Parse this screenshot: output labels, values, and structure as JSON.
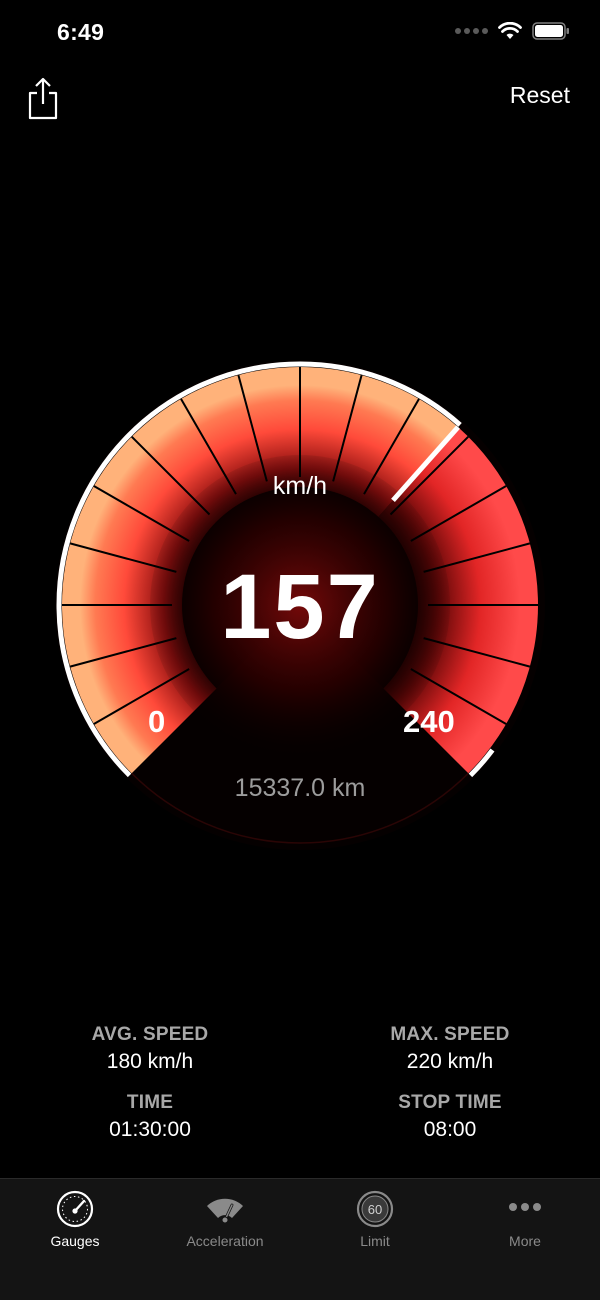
{
  "status_bar": {
    "time": "6:49",
    "icons": [
      "signal-dots-icon",
      "wifi-icon",
      "battery-icon"
    ]
  },
  "top_bar": {
    "share_icon": "share-icon",
    "reset_label": "Reset"
  },
  "gauge": {
    "unit": "km/h",
    "speed": "157",
    "min_label": "0",
    "max_label": "240",
    "odometer": "15337.0 km",
    "speed_value": 157,
    "min_value": 0,
    "max_value": 240,
    "colors": {
      "active": "#ff3b3b",
      "glow": "#ffb27a",
      "needle": "#ffffff",
      "rim": "#ffffff"
    }
  },
  "stats": {
    "avg_speed": {
      "label": "AVG. SPEED",
      "value": "180 km/h"
    },
    "max_speed": {
      "label": "MAX. SPEED",
      "value": "220 km/h"
    },
    "time": {
      "label": "TIME",
      "value": "01:30:00"
    },
    "stop_time": {
      "label": "STOP TIME",
      "value": "08:00"
    }
  },
  "tabs": [
    {
      "label": "Gauges",
      "icon": "speedometer-icon",
      "active": true
    },
    {
      "label": "Acceleration",
      "icon": "acceleration-gauge-icon",
      "active": false
    },
    {
      "label": "Limit",
      "icon": "speed-limit-icon",
      "icon_text": "60",
      "active": false
    },
    {
      "label": "More",
      "icon": "more-dots-icon",
      "active": false
    }
  ]
}
